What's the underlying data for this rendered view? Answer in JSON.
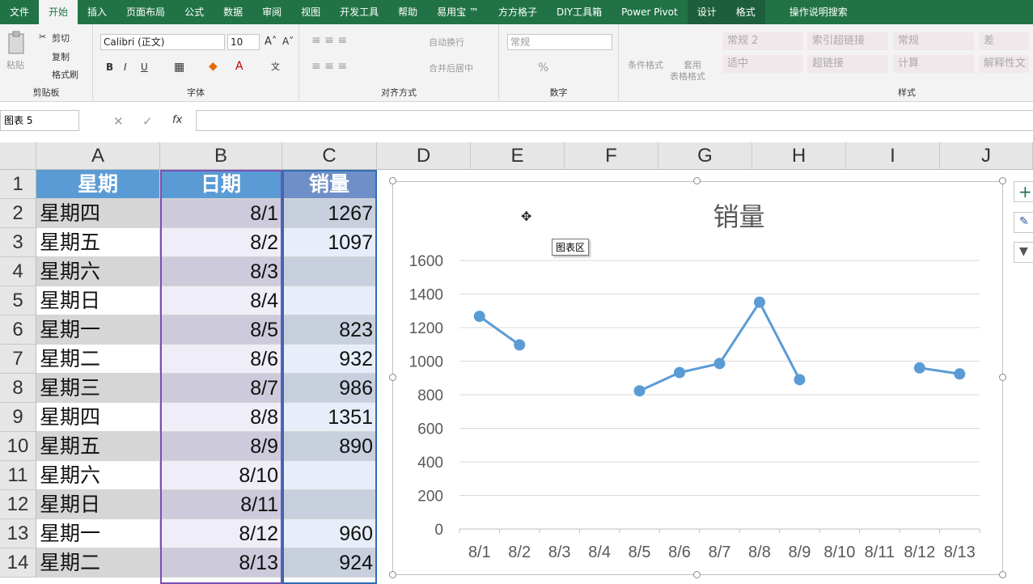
{
  "menu": {
    "tabs": [
      "文件",
      "开始",
      "插入",
      "页面布局",
      "公式",
      "数据",
      "审阅",
      "视图",
      "开发工具",
      "帮助",
      "易用宝 ™",
      "方方格子",
      "DIY工具箱",
      "Power Pivot",
      "设计",
      "格式"
    ],
    "active_index": 1,
    "search_label": "操作说明搜索"
  },
  "ribbon": {
    "clipboard": {
      "paste": "粘贴",
      "cut": "剪切",
      "copy": "复制",
      "format_painter": "格式刷",
      "label": "剪贴板"
    },
    "font": {
      "name": "Calibri (正文)",
      "size": "10",
      "label": "字体",
      "bold": "B",
      "italic": "I",
      "underline": "U"
    },
    "alignment": {
      "wrap": "自动换行",
      "merge": "合并后居中",
      "label": "对齐方式"
    },
    "number": {
      "format": "常规",
      "percent": "%",
      "label": "数字"
    },
    "styles": {
      "conditional": "条件格式",
      "table1": "套用",
      "table2": "表格格式",
      "cells": [
        "常规 2",
        "索引超链接",
        "常规",
        "差",
        "适中",
        "超链接",
        "计算",
        "解释性文"
      ],
      "label": "样式"
    }
  },
  "formula_bar": {
    "name_box": "图表 5",
    "fx": "fx",
    "value": ""
  },
  "sheet": {
    "columns": [
      "A",
      "B",
      "C",
      "D",
      "E",
      "F",
      "G",
      "H",
      "I",
      "J"
    ],
    "rows": [
      "1",
      "2",
      "3",
      "4",
      "5",
      "6",
      "7",
      "8",
      "9",
      "10",
      "11",
      "12",
      "13",
      "14"
    ],
    "header": [
      "星期",
      "日期",
      "销量"
    ],
    "data": [
      [
        "星期四",
        "8/1",
        "1267"
      ],
      [
        "星期五",
        "8/2",
        "1097"
      ],
      [
        "星期六",
        "8/3",
        ""
      ],
      [
        "星期日",
        "8/4",
        ""
      ],
      [
        "星期一",
        "8/5",
        "823"
      ],
      [
        "星期二",
        "8/6",
        "932"
      ],
      [
        "星期三",
        "8/7",
        "986"
      ],
      [
        "星期四",
        "8/8",
        "1351"
      ],
      [
        "星期五",
        "8/9",
        "890"
      ],
      [
        "星期六",
        "8/10",
        ""
      ],
      [
        "星期日",
        "8/11",
        ""
      ],
      [
        "星期一",
        "8/12",
        "960"
      ],
      [
        "星期二",
        "8/13",
        "924"
      ]
    ]
  },
  "tooltip": "图表区",
  "chart_data": {
    "type": "line",
    "title": "销量",
    "categories": [
      "8/1",
      "8/2",
      "8/3",
      "8/4",
      "8/5",
      "8/6",
      "8/7",
      "8/8",
      "8/9",
      "8/10",
      "8/11",
      "8/12",
      "8/13"
    ],
    "values": [
      1267,
      1097,
      null,
      null,
      823,
      932,
      986,
      1351,
      890,
      null,
      null,
      960,
      924
    ],
    "ylim": [
      0,
      1600
    ],
    "yticks": [
      0,
      200,
      400,
      600,
      800,
      1000,
      1200,
      1400,
      1600
    ],
    "grid": true,
    "color": "#5b9bd5"
  }
}
